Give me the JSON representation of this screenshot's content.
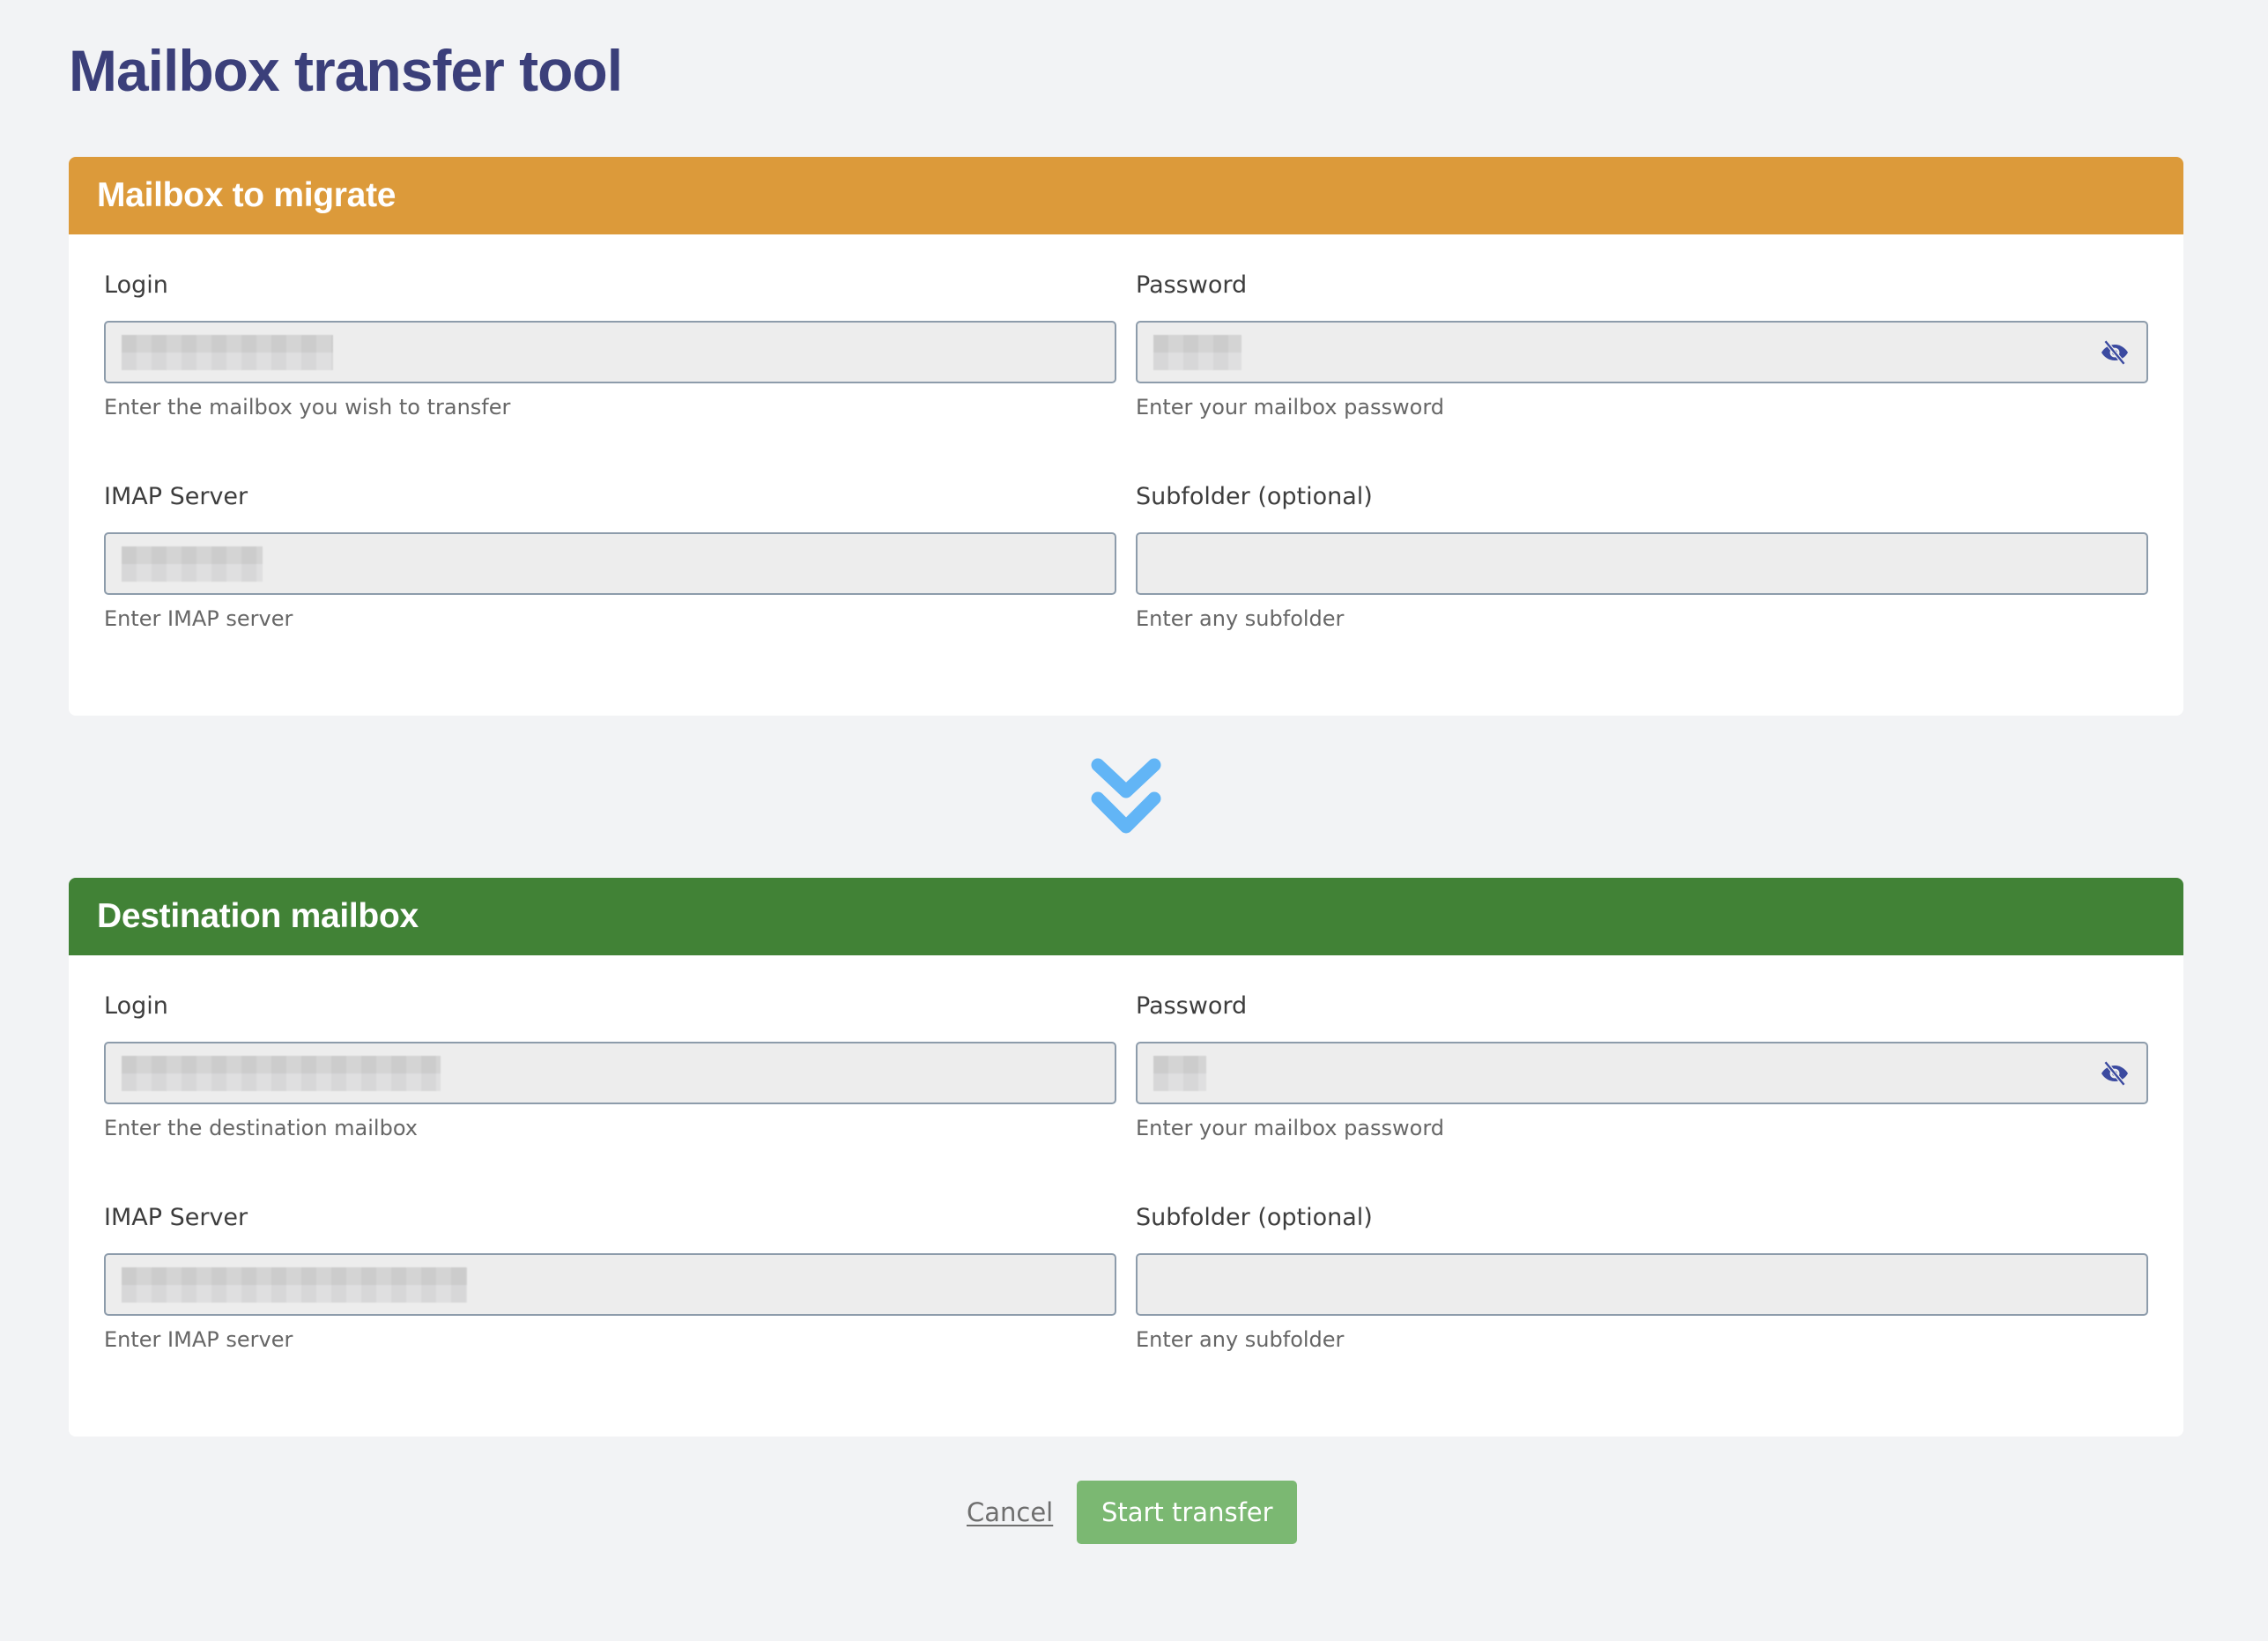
{
  "page": {
    "title": "Mailbox transfer tool",
    "background_color": "#f2f3f5",
    "title_color": "#3b3f7a"
  },
  "source": {
    "title": "Mailbox to migrate",
    "header_color": "#dc9a3a",
    "fields": {
      "login": {
        "label": "Login",
        "value": "",
        "value_redacted": true,
        "help": "Enter the mailbox you wish to transfer"
      },
      "password": {
        "label": "Password",
        "value": "",
        "value_redacted": true,
        "visibility_icon": "eye-slash-icon",
        "help": "Enter your mailbox password"
      },
      "imap_server": {
        "label": "IMAP Server",
        "value": "",
        "value_redacted": true,
        "help": "Enter IMAP server"
      },
      "subfolder": {
        "label": "Subfolder (optional)",
        "value": "",
        "help": "Enter any subfolder"
      }
    }
  },
  "separator_icon": "double-chevron-down-icon",
  "separator_color": "#62b5f6",
  "destination": {
    "title": "Destination mailbox",
    "header_color": "#418236",
    "fields": {
      "login": {
        "label": "Login",
        "value": "",
        "value_redacted": true,
        "help": "Enter the destination mailbox"
      },
      "password": {
        "label": "Password",
        "value": "",
        "value_redacted": true,
        "visibility_icon": "eye-slash-icon",
        "help": "Enter your mailbox password"
      },
      "imap_server": {
        "label": "IMAP Server",
        "value": "",
        "value_redacted": true,
        "help": "Enter IMAP server"
      },
      "subfolder": {
        "label": "Subfolder (optional)",
        "value": "",
        "help": "Enter any subfolder"
      }
    }
  },
  "actions": {
    "cancel_label": "Cancel",
    "submit_label": "Start transfer",
    "submit_color": "#7bb872"
  }
}
